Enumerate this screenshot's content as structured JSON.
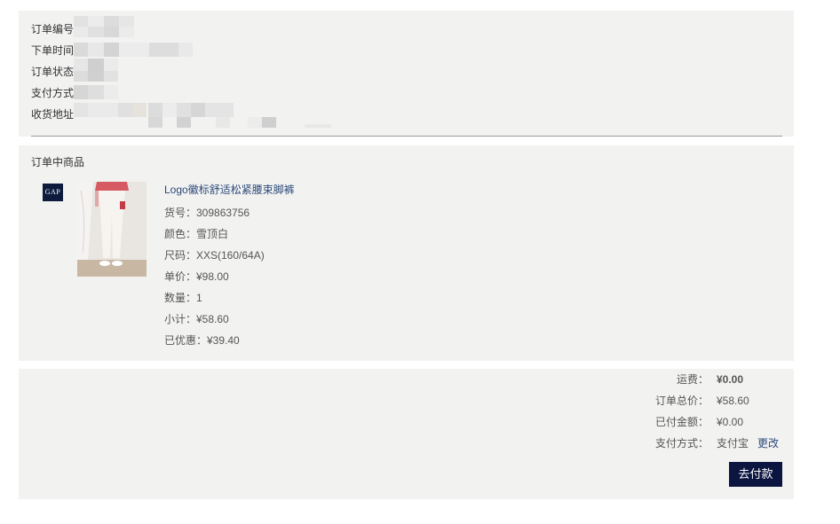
{
  "order_info": {
    "fields": [
      {
        "label": "订单编号"
      },
      {
        "label": "下单时间"
      },
      {
        "label": "订单状态"
      },
      {
        "label": "支付方式"
      },
      {
        "label": "收货地址"
      }
    ]
  },
  "products": {
    "section_title": "订单中商品",
    "brand_logo_text": "GAP",
    "item": {
      "name": "Logo徽标舒适松紧腰束脚裤",
      "sku": "货号：309863756",
      "color": "颜色：雪顶白",
      "size": "尺码：XXS(160/64A)",
      "unit_price": "单价：¥98.00",
      "quantity": "数量：1",
      "subtotal": "小计：¥58.60",
      "discount": "已优惠：¥39.40"
    }
  },
  "summary": {
    "shipping_label": "运费：",
    "shipping_value": "¥0.00",
    "total_label": "订单总价：",
    "total_value": "¥58.60",
    "paid_label": "已付金额：",
    "paid_value": "¥0.00",
    "payment_label": "支付方式：",
    "payment_value": "支付宝",
    "change_link": "更改",
    "pay_button": "去付款"
  },
  "colors": {
    "panel_bg": "#f2f2f1",
    "link": "#2c4a7a",
    "button_bg": "#0b1540",
    "brand_navy": "#0e1b3d"
  }
}
